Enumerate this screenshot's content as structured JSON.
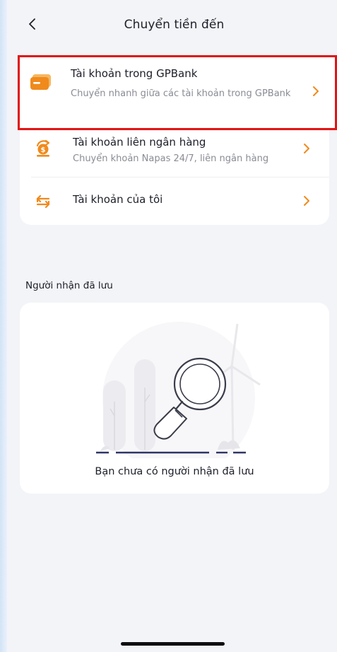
{
  "header": {
    "title": "Chuyển tiền đến",
    "back_icon": "chevron-left-icon"
  },
  "transfer_options": [
    {
      "title": "Tài khoản trong GPBank",
      "subtitle": "Chuyển nhanh giữa các tài khoản trong GPBank",
      "icon": "card-icon",
      "highlighted": true
    },
    {
      "title": "Tài khoản liên ngân hàng",
      "subtitle": "Chuyển khoản Napas 24/7, liên ngân hàng",
      "icon": "interbank-icon",
      "highlighted": false
    },
    {
      "title": "Tài khoản của tôi",
      "subtitle": "",
      "icon": "swap-arrows-icon",
      "highlighted": false
    }
  ],
  "saved_recipients": {
    "label": "Người nhận đã lưu",
    "empty_text": "Bạn chưa có người nhận đã lưu",
    "illustration_icon": "magnifying-glass-icon"
  },
  "colors": {
    "accent_orange": "#f08a1c",
    "highlight_red": "#e31414",
    "background": "#f3f4f8",
    "illustration_navy": "#2f3566"
  }
}
